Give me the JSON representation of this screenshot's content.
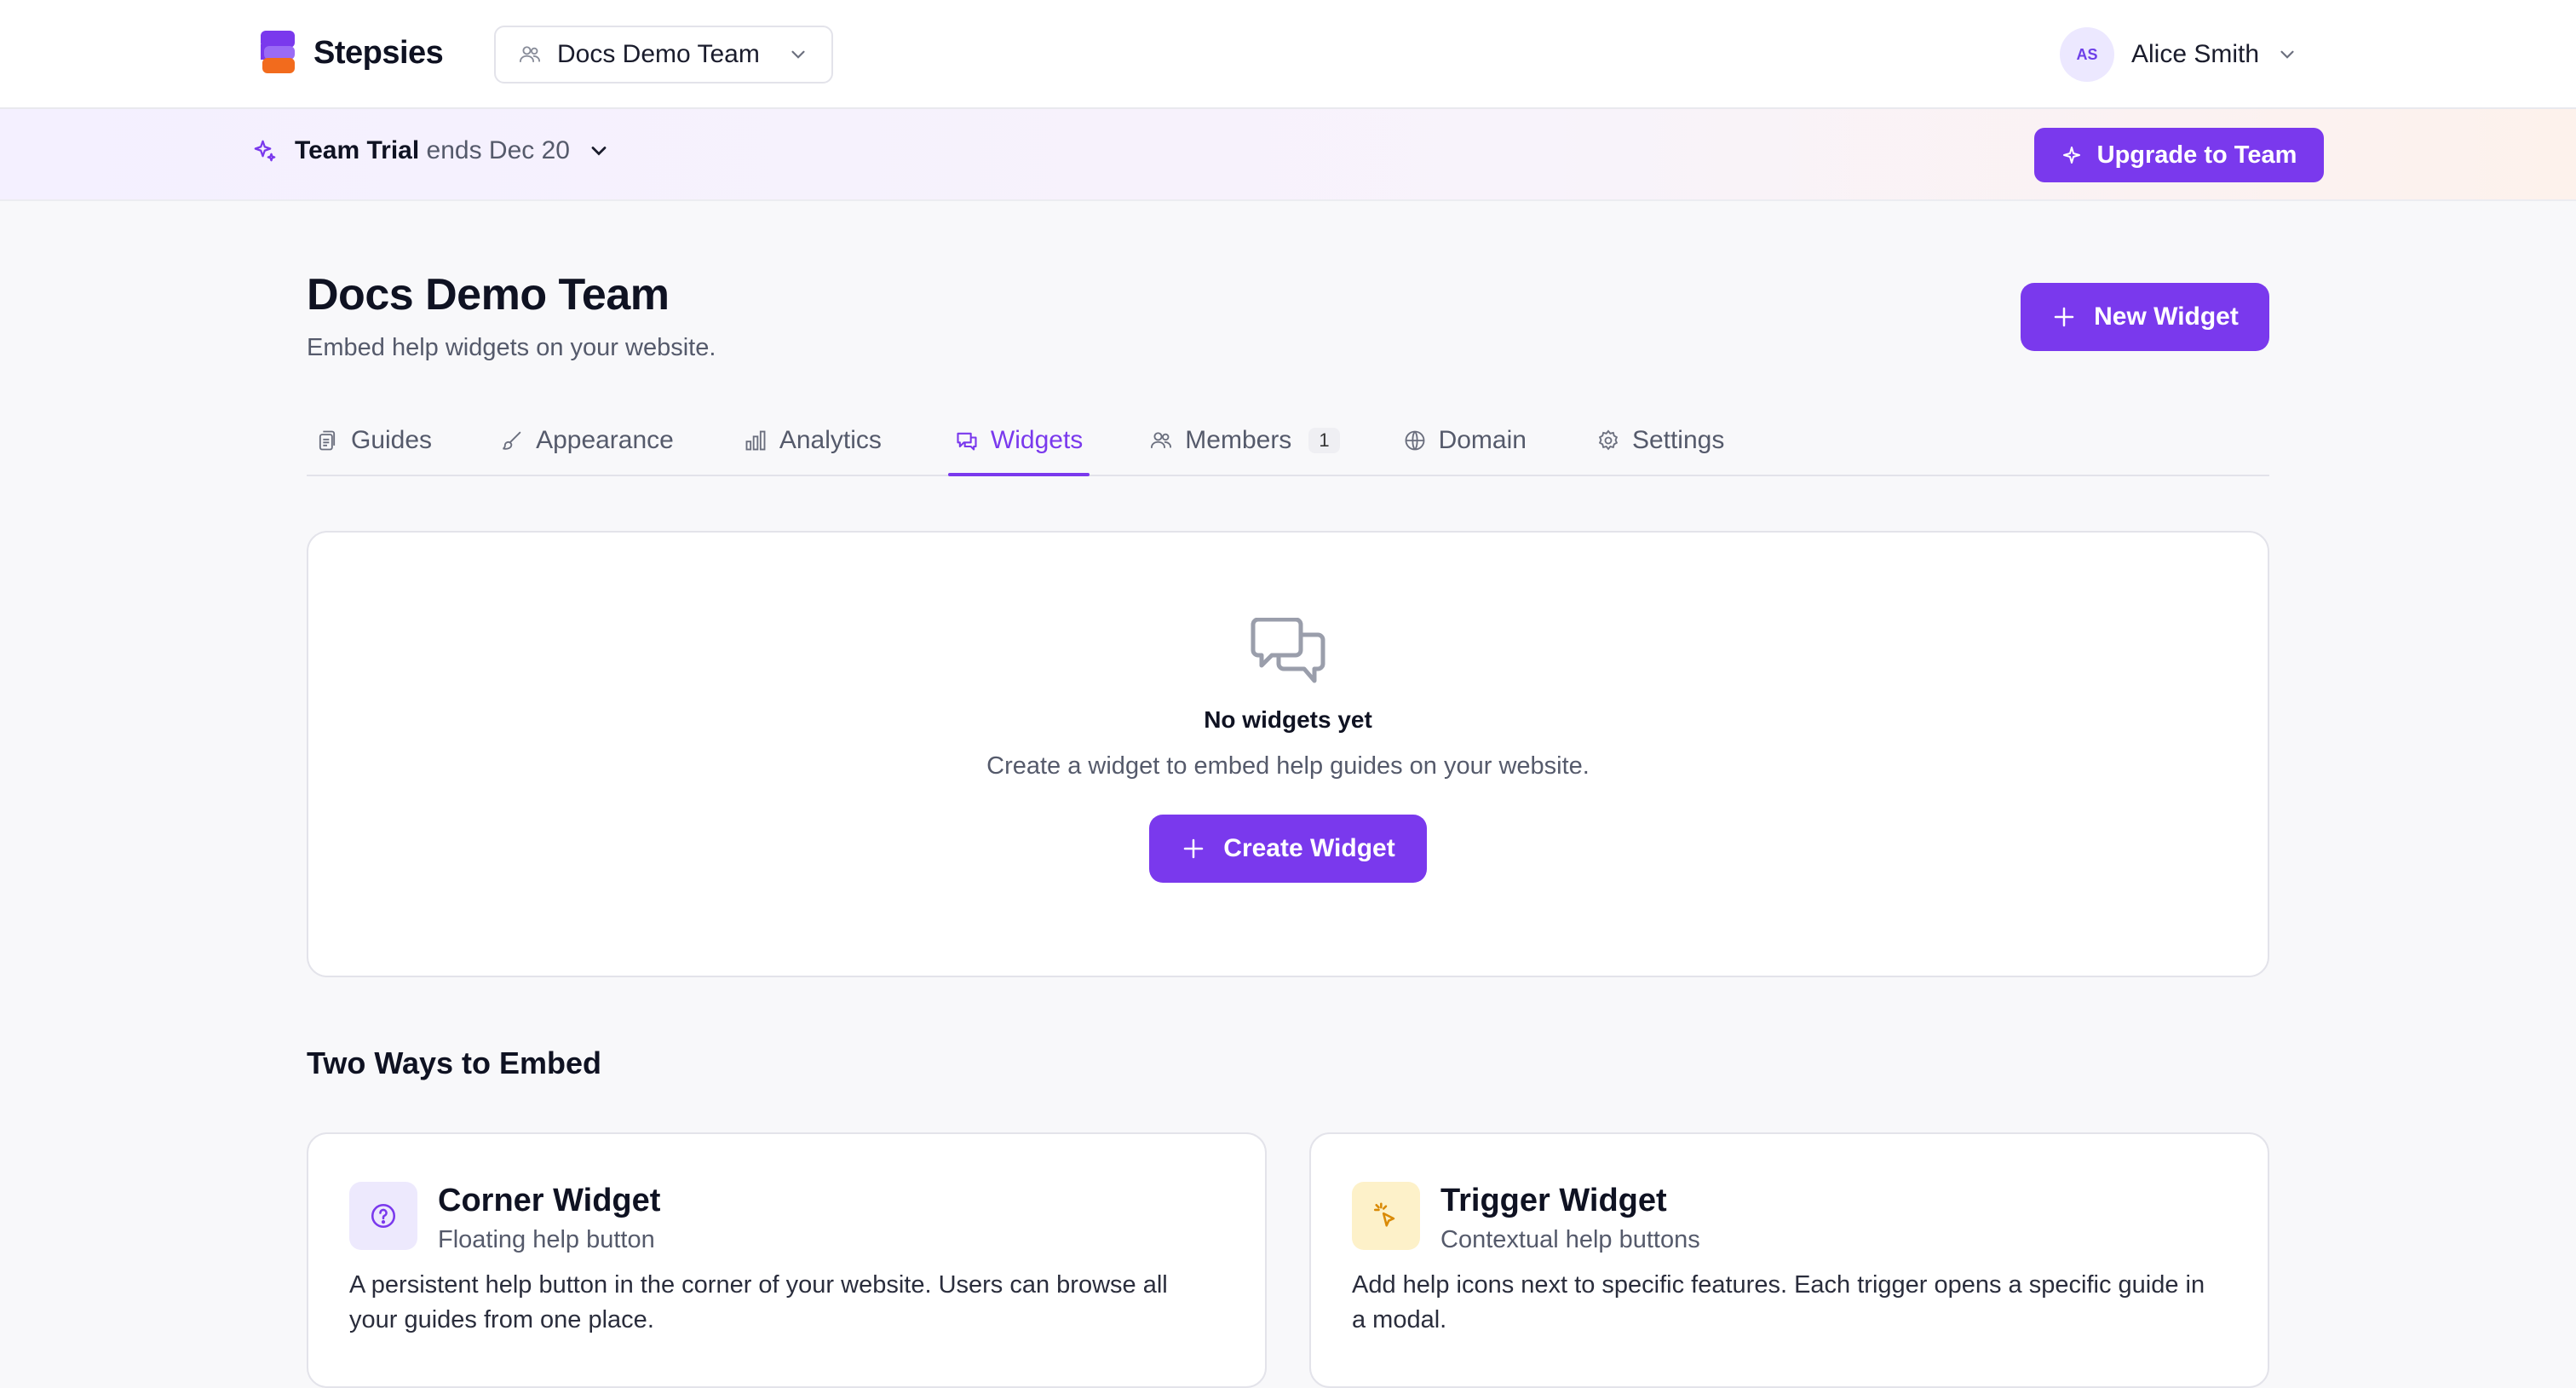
{
  "app": {
    "name": "Stepsies"
  },
  "header": {
    "team_selector": "Docs Demo Team",
    "user": {
      "initials": "AS",
      "name": "Alice Smith"
    }
  },
  "trial": {
    "plan": "Team Trial",
    "ends": "ends Dec 20",
    "upgrade_label": "Upgrade to Team"
  },
  "page": {
    "title": "Docs Demo Team",
    "subtitle": "Embed help widgets on your website.",
    "new_widget_label": "New Widget"
  },
  "tabs": [
    {
      "label": "Guides",
      "icon": "guides-icon"
    },
    {
      "label": "Appearance",
      "icon": "brush-icon"
    },
    {
      "label": "Analytics",
      "icon": "bar-chart-icon"
    },
    {
      "label": "Widgets",
      "icon": "chat-icon",
      "active": true
    },
    {
      "label": "Members",
      "icon": "users-icon",
      "badge": "1"
    },
    {
      "label": "Domain",
      "icon": "globe-icon"
    },
    {
      "label": "Settings",
      "icon": "gear-icon"
    }
  ],
  "empty_state": {
    "title": "No widgets yet",
    "subtitle": "Create a widget to embed help guides on your website.",
    "button_label": "Create Widget"
  },
  "embed_section": {
    "title": "Two Ways to Embed",
    "cards": [
      {
        "title": "Corner Widget",
        "subtitle": "Floating help button",
        "description": "A persistent help button in the corner of your website. Users can browse all your guides from one place.",
        "icon": "help-circle-icon"
      },
      {
        "title": "Trigger Widget",
        "subtitle": "Contextual help buttons",
        "description": "Add help icons next to specific features. Each trigger opens a specific guide in a modal.",
        "icon": "click-cursor-icon"
      }
    ]
  },
  "colors": {
    "accent": "#7a39ed",
    "logo_orange": "#f26b1d",
    "trigger_bg": "#fdf1c9"
  }
}
